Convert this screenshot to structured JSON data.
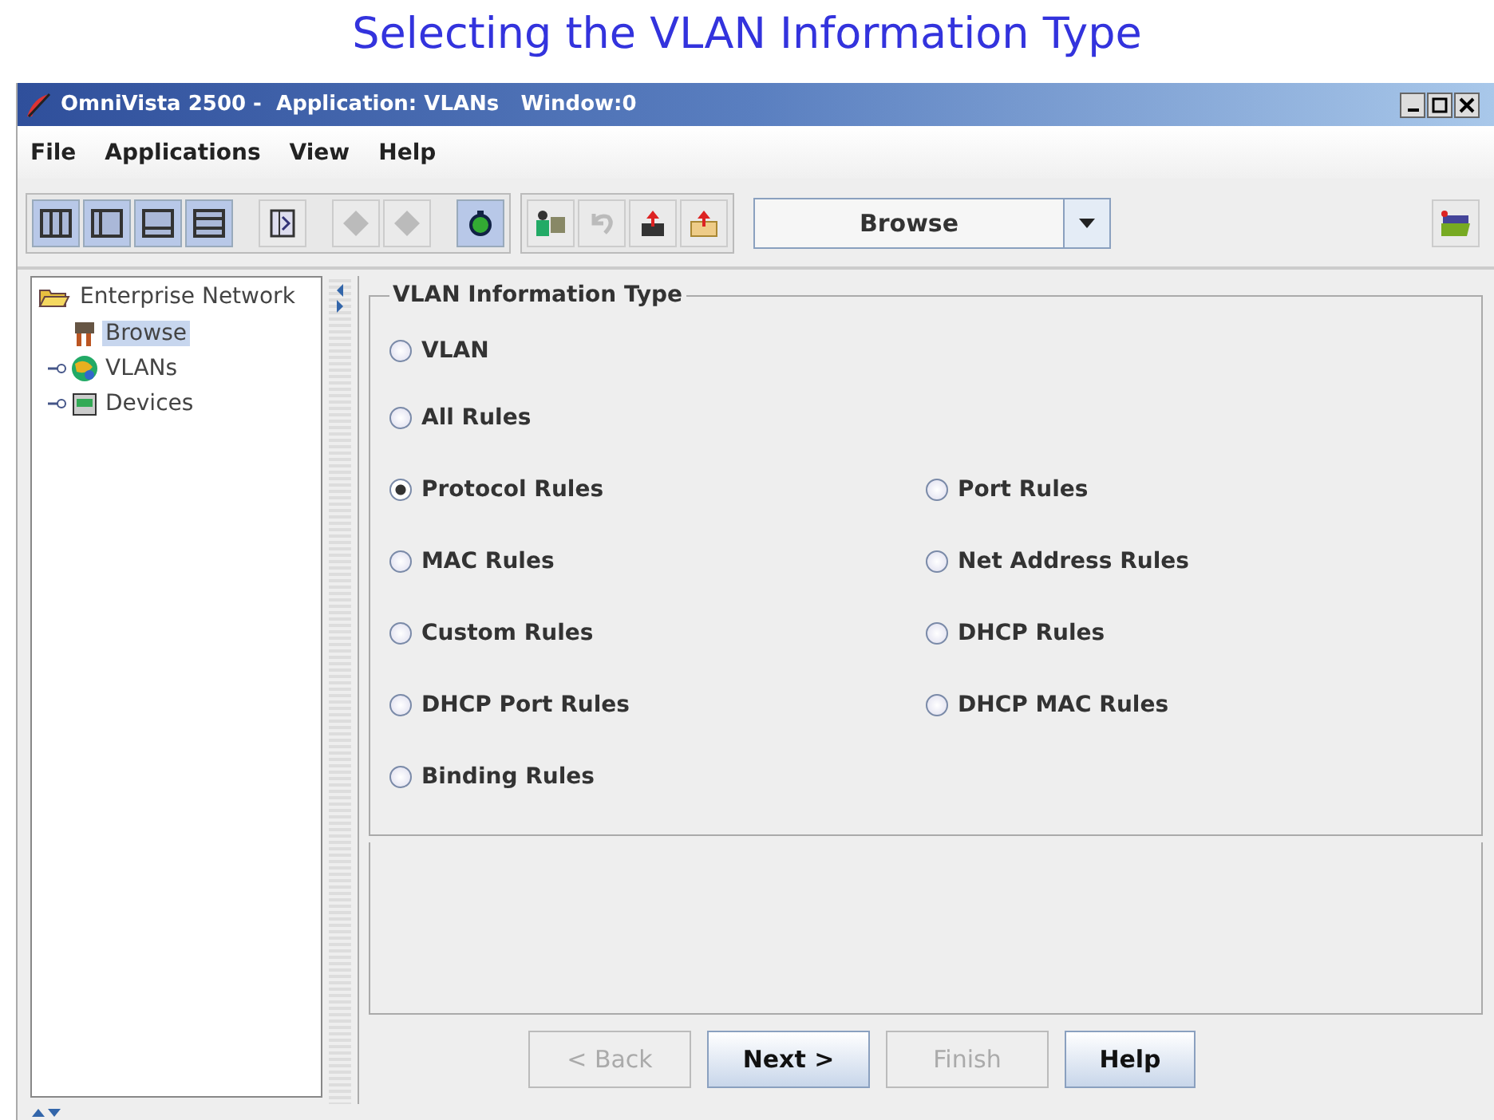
{
  "caption": "Selecting the VLAN Information Type",
  "window": {
    "title": "OmniVista 2500 -  Application: VLANs   Window:0"
  },
  "menu": [
    "File",
    "Applications",
    "View",
    "Help"
  ],
  "view_select": {
    "value": "Browse"
  },
  "tree": {
    "label": "Enterprise Network",
    "expanded": true,
    "children": [
      {
        "label": "Browse",
        "selected": true
      },
      {
        "label": "VLANs",
        "selected": false,
        "expanded": false
      },
      {
        "label": "Devices",
        "selected": false,
        "expanded": false
      }
    ]
  },
  "group": {
    "title": "VLAN Information Type",
    "rows": [
      [
        {
          "label": "VLAN",
          "selected": false
        }
      ],
      [
        {
          "label": "All Rules",
          "selected": false
        }
      ],
      [
        {
          "label": "Protocol Rules",
          "selected": true
        },
        {
          "label": "Port Rules",
          "selected": false
        }
      ],
      [
        {
          "label": "MAC Rules",
          "selected": false
        },
        {
          "label": "Net Address Rules",
          "selected": false
        }
      ],
      [
        {
          "label": "Custom Rules",
          "selected": false
        },
        {
          "label": "DHCP Rules",
          "selected": false
        }
      ],
      [
        {
          "label": "DHCP Port Rules",
          "selected": false
        },
        {
          "label": "DHCP MAC Rules",
          "selected": false
        }
      ],
      [
        {
          "label": "Binding Rules",
          "selected": false
        }
      ]
    ]
  },
  "buttons": [
    {
      "label": "< Back",
      "disabled": true
    },
    {
      "label": "Next >",
      "disabled": false
    },
    {
      "label": "Finish",
      "disabled": true
    },
    {
      "label": "Help",
      "disabled": false
    }
  ]
}
